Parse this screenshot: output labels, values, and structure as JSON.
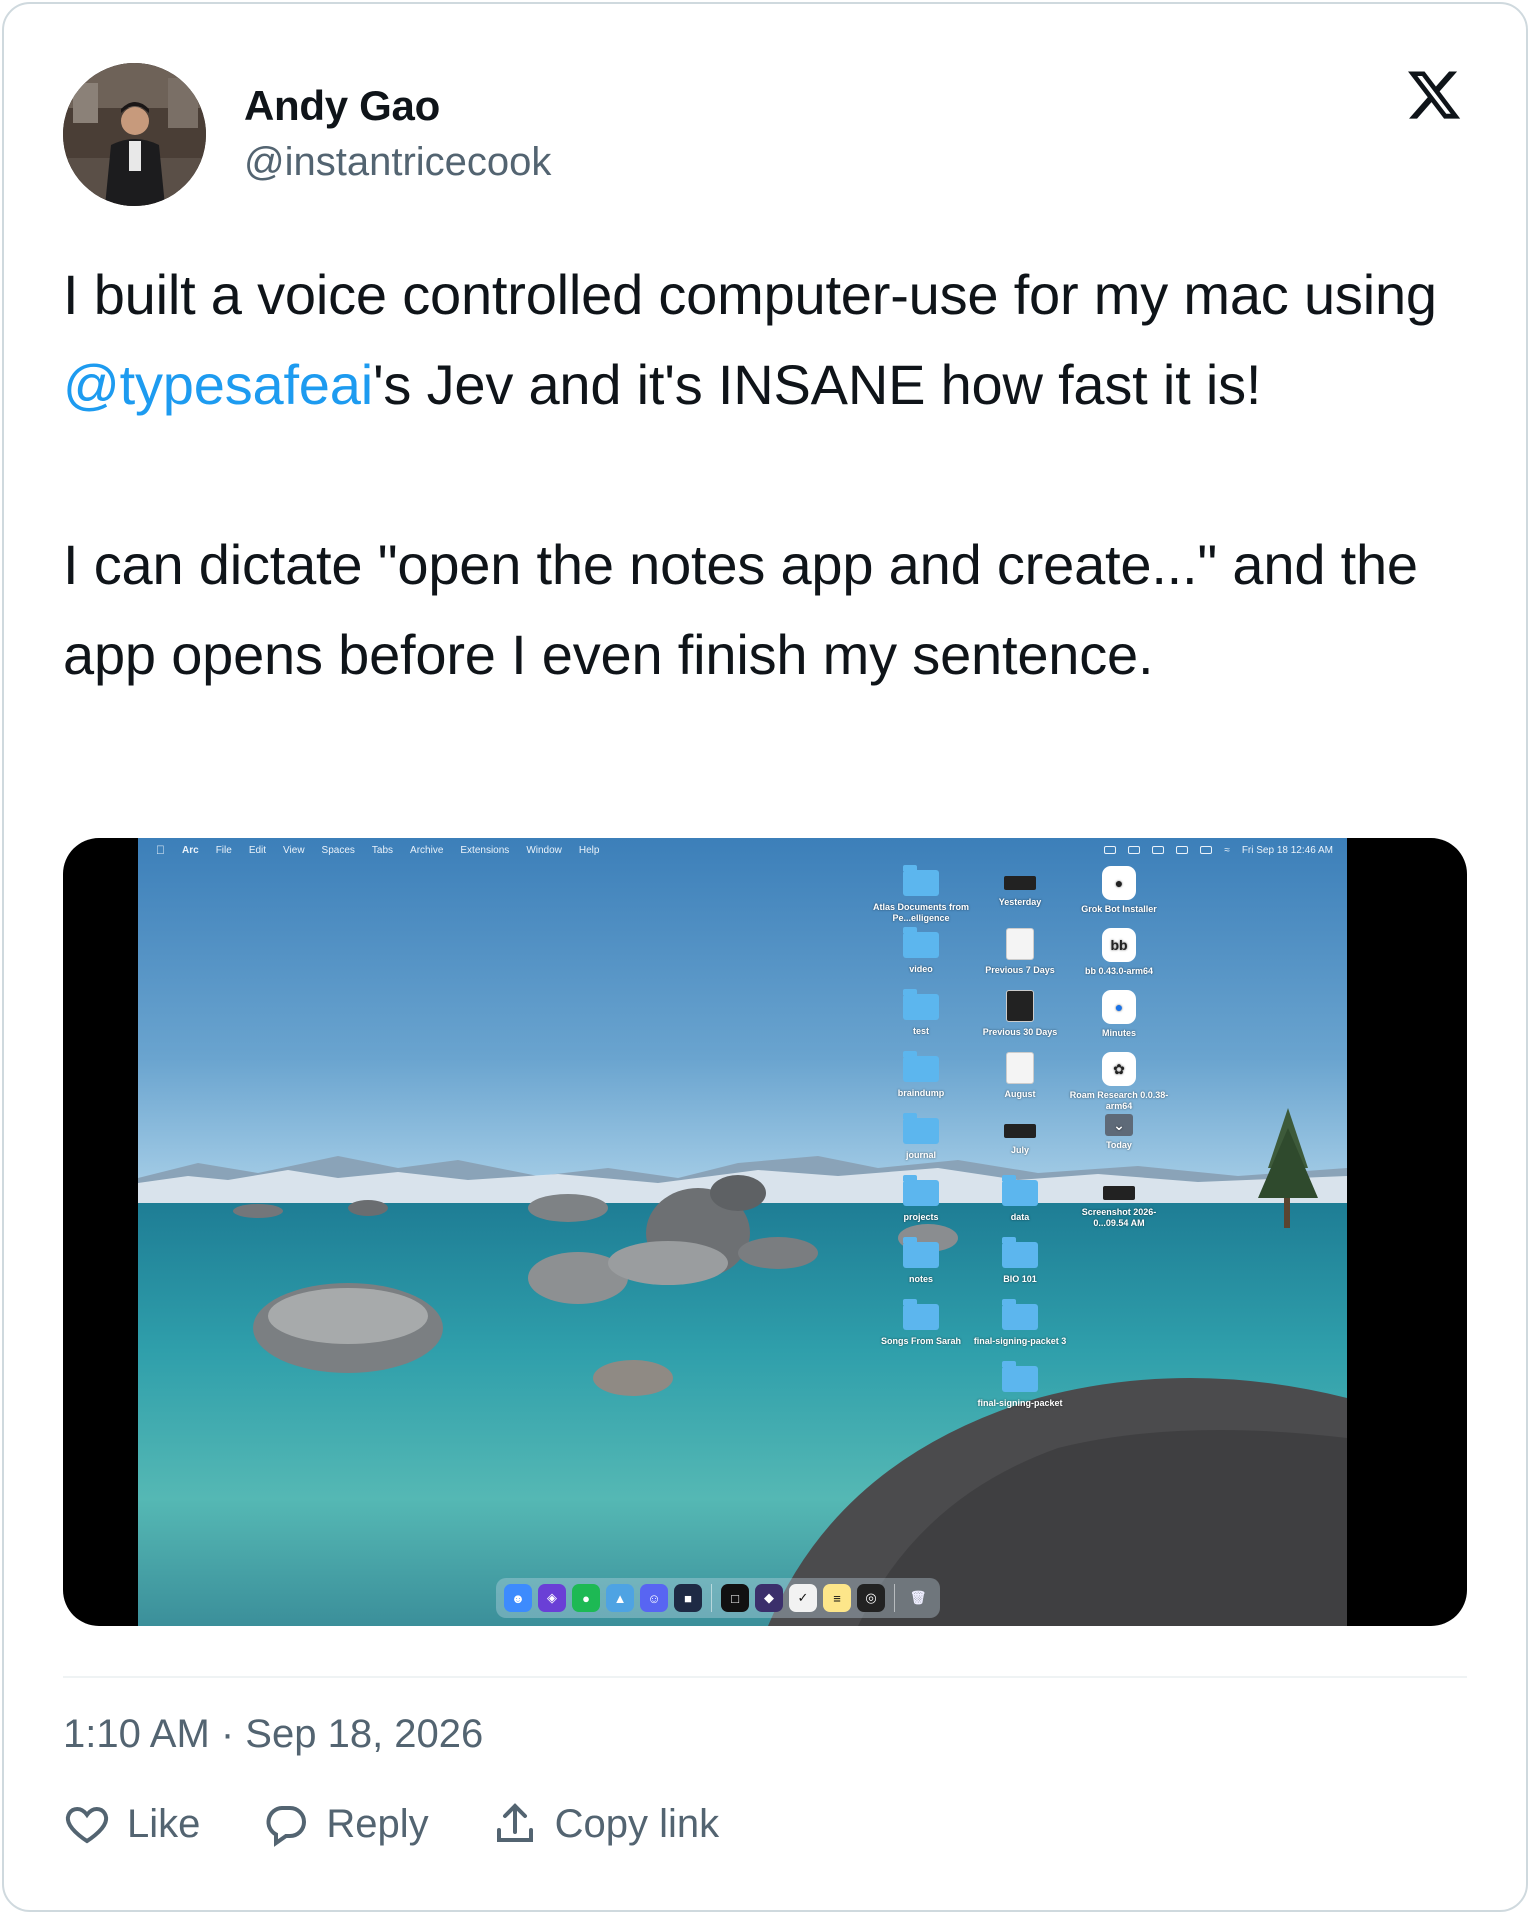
{
  "author": {
    "name": "Andy Gao",
    "handle": "@instantricecook"
  },
  "platform_icon": "x-logo-icon",
  "tweet": {
    "line1_pre": "I built a voice controlled computer-use for my mac using ",
    "mention": "@typesafeai",
    "line1_post": "'s Jev and it's INSANE how fast it is!",
    "paragraph2": "I can dictate \"open the notes app and create...\" and the app opens before I even finish my sentence."
  },
  "media": {
    "menubar": {
      "app_name": "Arc",
      "items": [
        "File",
        "Edit",
        "View",
        "Spaces",
        "Tabs",
        "Archive",
        "Extensions",
        "Window",
        "Help"
      ],
      "clock": "Fri Sep 18  12:46 AM"
    },
    "desktop_icons": {
      "col1": [
        "Atlas Documents from Pe...elligence",
        "video",
        "test",
        "braindump",
        "journal",
        "projects",
        "notes",
        "Songs From Sarah"
      ],
      "col2": [
        "Yesterday",
        "Previous 7 Days",
        "Previous 30 Days",
        "August",
        "July",
        "data",
        "BIO 101",
        "final-signing-packet 3",
        "final-signing-packet"
      ],
      "col3": [
        "Grok Bot Installer",
        "bb 0.43.0-arm64",
        "Minutes",
        "Roam Research 0.0.38-arm64",
        "Today",
        "Screenshot 2026-0...09.54 AM"
      ],
      "bb_glyph": "bb"
    }
  },
  "timestamp": "1:10 AM · Sep 18, 2026",
  "actions": {
    "like": "Like",
    "reply": "Reply",
    "copy_link": "Copy link"
  },
  "colors": {
    "link": "#1d9bf0",
    "secondary_text": "#536471",
    "border": "#cfd9de"
  }
}
